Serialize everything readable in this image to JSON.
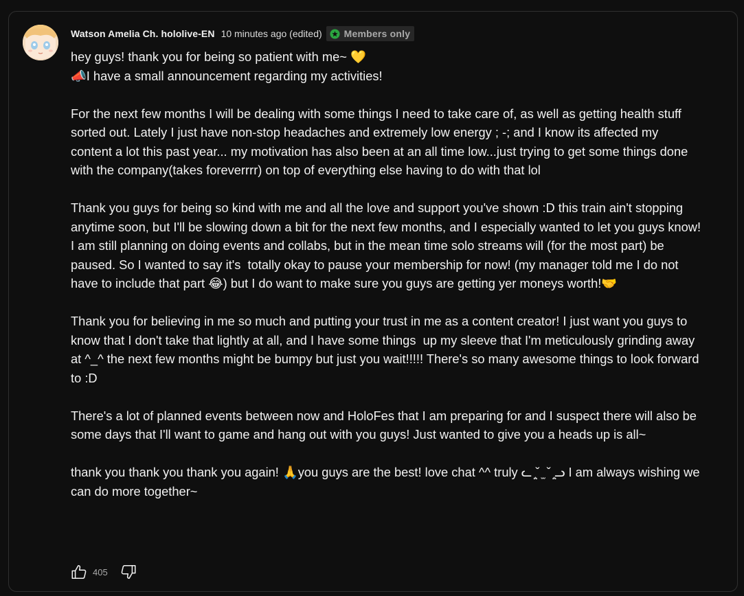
{
  "comment": {
    "author": "Watson Amelia Ch. hololive-EN",
    "timestamp": "10 minutes ago (edited)",
    "badge": {
      "label": "Members only",
      "icon": "members-star-icon",
      "icon_color": "#2ba640"
    },
    "lines": [
      "hey guys! thank you for being so patient with me~ 💛",
      "📣I have a small announcement regarding my activities!"
    ],
    "paragraphs": [
      "For the next few months I will be dealing with some things I need to take care of, as well as getting health stuff sorted out. Lately I just have non-stop headaches and extremely low energy ; -; and I know its affected my content a lot this past year... my motivation has also been at an all time low...just trying to get some things done with the company(takes foreverrrr) on top of everything else having to do with that lol",
      "Thank you guys for being so kind with me and all the love and support you've shown :D this train ain't stopping anytime soon, but I'll be slowing down a bit for the next few months, and I especially wanted to let you guys know! I am still planning on doing events and collabs, but in the mean time solo streams will (for the most part) be paused. So I wanted to say it's  totally okay to pause your membership for now! (my manager told me I do not have to include that part 😂) but I do want to make sure you guys are getting yer moneys worth!🤝",
      "Thank you for believing in me so much and putting your trust in me as a content creator! I just want you guys to know that I don't take that lightly at all, and I have some things  up my sleeve that I'm meticulously grinding away at ^_^ the next few months might be bumpy but just you wait!!!!! There's so many awesome things to look forward to :D",
      "There's a lot of planned events between now and HoloFes that I am preparing for and I suspect there will also be some days that I'll want to game and hang out with you guys! Just wanted to give you a heads up is all~",
      "thank you thank you thank you again! 🙏you guys are the best! love chat ^^ truly ᓚ ̤͙ˇ ̫ ˇ ̤͙ᓗ I am always wishing we can do more together~"
    ],
    "likes": "405"
  },
  "icons": {
    "like": "thumbs-up-icon",
    "dislike": "thumbs-down-icon",
    "avatar": "avatar"
  }
}
